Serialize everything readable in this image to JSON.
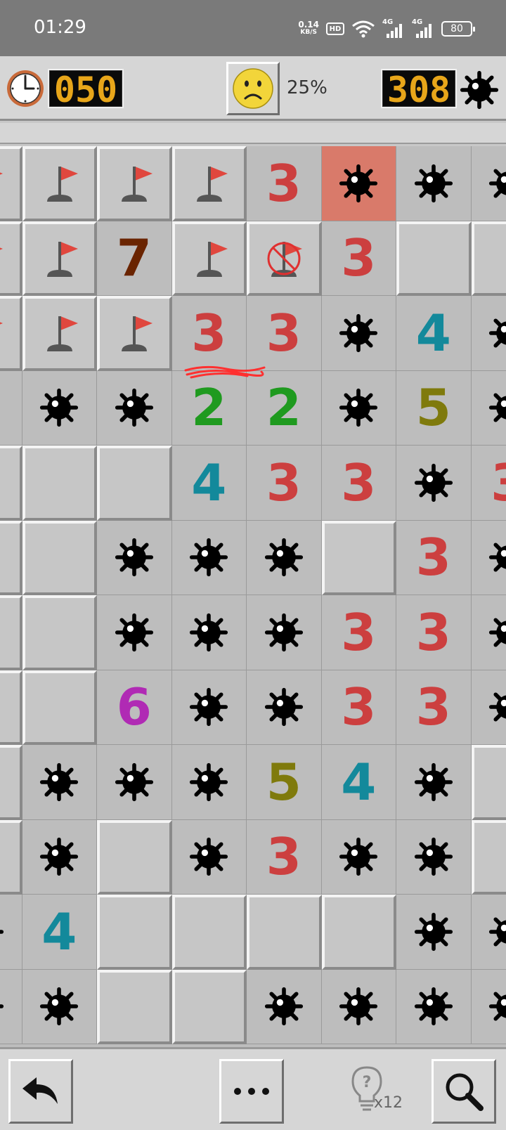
{
  "status_bar": {
    "time": "01:29",
    "net_speed": "0.14",
    "net_unit": "KB/S",
    "hd_label": "HD",
    "signal_1": "4G",
    "signal_2": "4G",
    "battery": "80"
  },
  "game_bar": {
    "timer": "050",
    "progress": "25%",
    "mines_left": "308",
    "face": "sad-face-icon"
  },
  "board": {
    "columns": 7,
    "rows": 12,
    "cell_legend": {
      "c": "covered",
      "f": "flag",
      "x": "wrong-flag",
      "m": "mine",
      "e": "exploded-mine",
      "o": "empty-open",
      "1-8": "number"
    },
    "number_colors": {
      "2": "#1f9a1f",
      "3": "#cc3f3f",
      "4": "#13899b",
      "5": "#7f7a0c",
      "6": "#b02ab4",
      "7": "#6a2400"
    },
    "grid": [
      [
        "f",
        "f",
        "f",
        "f",
        "3",
        "e",
        "m",
        "m"
      ],
      [
        "f",
        "f",
        "7",
        "f",
        "x",
        "3",
        "c",
        "c"
      ],
      [
        "f",
        "f",
        "f",
        "3",
        "3",
        "m",
        "4",
        "m"
      ],
      [
        "o",
        "m",
        "m",
        "2",
        "2",
        "m",
        "5",
        "m"
      ],
      [
        "c",
        "c",
        "c",
        "4",
        "3",
        "3",
        "m",
        "3"
      ],
      [
        "c",
        "c",
        "m",
        "m",
        "m",
        "c",
        "3",
        "m"
      ],
      [
        "c",
        "c",
        "m",
        "m",
        "m",
        "3",
        "3",
        "m"
      ],
      [
        "c",
        "c",
        "6",
        "m",
        "m",
        "3",
        "3",
        "m"
      ],
      [
        "c",
        "m",
        "m",
        "m",
        "5",
        "4",
        "m",
        "c"
      ],
      [
        "c",
        "m",
        "c",
        "m",
        "3",
        "m",
        "m",
        "c"
      ],
      [
        "m",
        "4",
        "c",
        "c",
        "c",
        "c",
        "m",
        "m"
      ],
      [
        "m",
        "m",
        "c",
        "c",
        "m",
        "m",
        "m",
        "m"
      ]
    ]
  },
  "toolbar": {
    "undo": "undo-arrow-icon",
    "more": "more-dots-icon",
    "hint": "lightbulb-hint-icon",
    "hint_count": "x12",
    "search": "magnifier-icon"
  }
}
